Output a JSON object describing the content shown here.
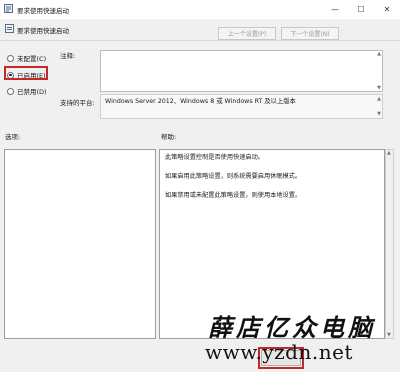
{
  "window": {
    "title": "要求使用快速启动",
    "controls": [
      "minimize",
      "maximize",
      "close"
    ]
  },
  "header": {
    "policy_name": "要求使用快速启动",
    "prev_button": "上一个设置(P)",
    "next_button": "下一个设置(N)"
  },
  "state_options": [
    {
      "label": "未配置(C)",
      "selected": false
    },
    {
      "label": "已启用(E)",
      "selected": true
    },
    {
      "label": "已禁用(D)",
      "selected": false
    }
  ],
  "comment": {
    "label": "注释:",
    "value": ""
  },
  "supported_on": {
    "label": "支持的平台:",
    "value": "Windows Server 2012、Windows 8 或 Windows RT 及以上版本"
  },
  "options_section": {
    "label": "选项:"
  },
  "help_section": {
    "label": "帮助:",
    "paragraphs": [
      "此策略设置控制是否使用快速启动。",
      "如果启用此策略设置，则系统需要启用休眠模式。",
      "如果禁用或未配置此策略设置，则使用本地设置。"
    ]
  },
  "watermark": {
    "cn_text": "薛店亿众电脑",
    "url": "www.yzdn.net"
  },
  "colors": {
    "highlight": "#c0282a",
    "window_bg": "#f0f0f0"
  }
}
